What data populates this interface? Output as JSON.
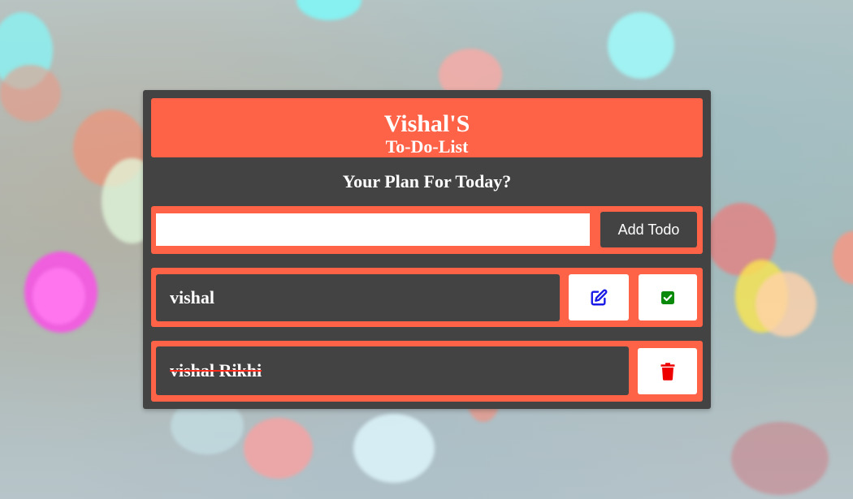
{
  "header": {
    "title": "Vishal'S",
    "subtitle": "To-Do-List"
  },
  "prompt": "Your Plan For Today?",
  "input": {
    "value": "",
    "placeholder": ""
  },
  "add_button_label": "Add Todo",
  "todos": [
    {
      "text": "vishal",
      "completed": false,
      "actions": [
        "edit-icon",
        "check-square-icon"
      ]
    },
    {
      "text": "vishal Rikhi",
      "completed": true,
      "actions": [
        "trash-icon"
      ]
    }
  ],
  "colors": {
    "accent": "#ff6347",
    "panel": "#434343",
    "edit_icon": "#1a1ae6",
    "check_icon": "#0a8a0a",
    "delete_icon": "#ee0000",
    "strike": "#ff2a1a"
  }
}
